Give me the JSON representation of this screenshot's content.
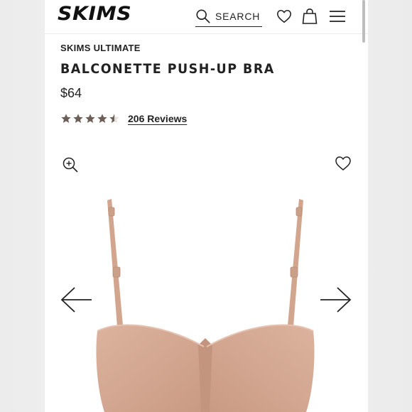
{
  "header": {
    "logo": "SKIMS",
    "search_label": "SEARCH"
  },
  "product": {
    "brand_line": "SKIMS ULTIMATE",
    "title": "BALCONETTE PUSH-UP BRA",
    "price": "$64",
    "rating": 4.5,
    "reviews_label": "206 Reviews"
  },
  "icons": {
    "search": "search-icon",
    "wishlist": "heart-icon",
    "cart": "shopping-bag-icon",
    "menu": "hamburger-menu-icon",
    "zoom": "zoom-in-icon",
    "favorite": "heart-outline-icon",
    "prev": "arrow-left-icon",
    "next": "arrow-right-icon"
  },
  "colors": {
    "text": "#222222",
    "star": "#6b5f58",
    "product": "#d7ad97"
  }
}
